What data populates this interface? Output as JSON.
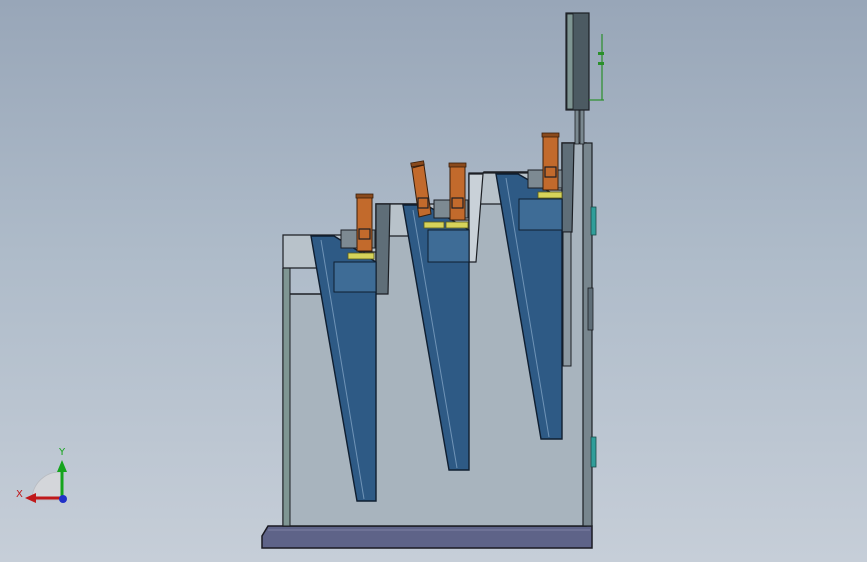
{
  "viewport": {
    "background_top": "#98a6b8",
    "background_bottom": "#c6ced8"
  },
  "triad": {
    "x_label": "X",
    "y_label": "Y",
    "x_color": "#c0191b",
    "y_color": "#15a41d",
    "z_color": "#2030c8"
  },
  "model": {
    "body_color": "#a8b4be",
    "plate_color": "#5e6388",
    "wedge_color": "#2e5a85",
    "cylinder_color": "#c26a2c",
    "pad_color": "#d6d35a",
    "frame_color": "#5f6e78",
    "accent_color": "#2f9e9a"
  }
}
